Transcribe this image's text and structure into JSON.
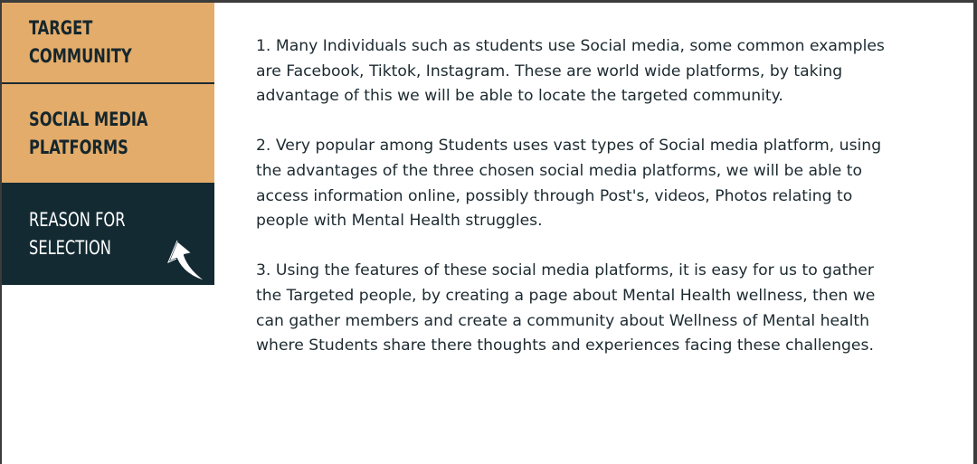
{
  "sidebar": {
    "items": [
      {
        "label": "TARGET COMMUNITY"
      },
      {
        "label": "SOCIAL MEDIA\nPLATFORMS"
      },
      {
        "label": "REASON FOR\nSELECTION"
      }
    ],
    "active_index": 2
  },
  "content": {
    "paragraphs": [
      "1. Many Individuals such as students use Social media, some common examples are Facebook, Tiktok, Instagram. These are world wide platforms, by taking advantage of this we will be able to locate the targeted community.",
      "2. Very popular among Students uses vast types of Social media platform, using the advantages of the three chosen social media platforms, we will be able to access information online, possibly through Post's, videos, Photos relating to people with Mental Health struggles.",
      "3. Using the features of these social media platforms, it is easy for us to gather the Targeted people, by creating a page about Mental Health wellness, then we can gather members and create a community about Wellness of Mental health where Students share there thoughts and experiences facing these challenges."
    ]
  },
  "colors": {
    "tab_inactive": "#e3ac6a",
    "tab_active": "#132a32",
    "text_dark": "#15262d",
    "frame_border": "#3c3c3c"
  },
  "icons": {
    "cursor": "cursor-arrow-icon"
  }
}
